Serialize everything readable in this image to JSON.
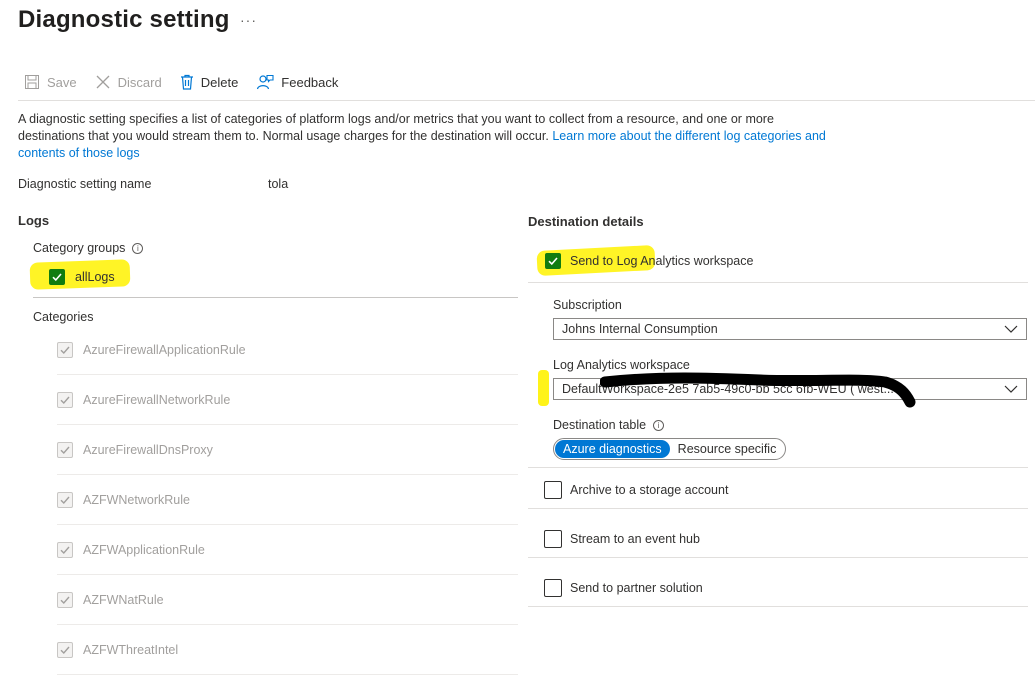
{
  "page": {
    "title": "Diagnostic setting",
    "more": "···"
  },
  "toolbar": {
    "save": "Save",
    "discard": "Discard",
    "delete": "Delete",
    "feedback": "Feedback"
  },
  "description": {
    "text": "A diagnostic setting specifies a list of categories of platform logs and/or metrics that you want to collect from a resource, and one or more destinations that you would stream them to. Normal usage charges for the destination will occur. ",
    "link": "Learn more about the different log categories and contents of those logs"
  },
  "setting_name": {
    "label": "Diagnostic setting name",
    "value": "tola"
  },
  "logs": {
    "heading": "Logs",
    "category_groups_label": "Category groups",
    "all_logs_label": "allLogs",
    "categories_label": "Categories",
    "categories": [
      "AzureFirewallApplicationRule",
      "AzureFirewallNetworkRule",
      "AzureFirewallDnsProxy",
      "AZFWNetworkRule",
      "AZFWApplicationRule",
      "AZFWNatRule",
      "AZFWThreatIntel"
    ]
  },
  "destination": {
    "heading": "Destination details",
    "log_analytics_label": "Send to Log Analytics workspace",
    "subscription_label": "Subscription",
    "subscription_value": "Johns Internal Consumption",
    "workspace_label": "Log Analytics workspace",
    "workspace_value": "DefaultWorkspace-2e5          7ab5-49c0-bb          5cc          6fb-WEU ( west...",
    "dest_table_label": "Destination table",
    "dest_table_options": [
      "Azure diagnostics",
      "Resource specific"
    ],
    "archive_label": "Archive to a storage account",
    "stream_label": "Stream to an event hub",
    "partner_label": "Send to partner solution"
  },
  "colors": {
    "accent": "#0078d4",
    "check_green": "#107c10",
    "highlight": "#fff200"
  }
}
